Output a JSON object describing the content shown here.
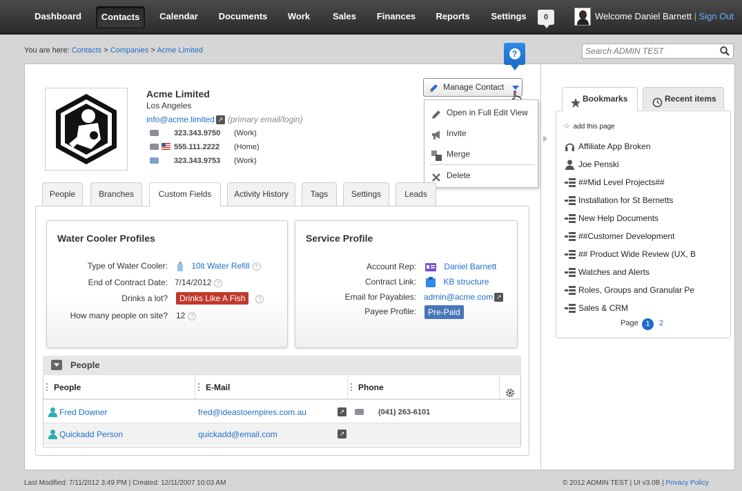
{
  "nav": {
    "items": [
      {
        "label": "Dashboard"
      },
      {
        "label": "Contacts"
      },
      {
        "label": "Calendar"
      },
      {
        "label": "Documents"
      },
      {
        "label": "Work"
      },
      {
        "label": "Sales"
      },
      {
        "label": "Finances"
      },
      {
        "label": "Reports"
      },
      {
        "label": "Settings"
      }
    ],
    "notifications": "0",
    "welcome": "Welcome Daniel Barnett",
    "separator": "|",
    "signout": "Sign Out"
  },
  "breadcrumb": {
    "prefix": "You are here:",
    "items": [
      "Contacts",
      "Companies",
      "Acme Limited"
    ],
    "sep": ">"
  },
  "search": {
    "placeholder": "Search ADMIN TEST"
  },
  "help": {
    "label": "?"
  },
  "contact": {
    "name": "Acme Limited",
    "city": "Los Angeles",
    "email": "info@acme.limited",
    "email_note": "(primary email/login)",
    "phones": [
      {
        "number": "323.343.9750",
        "type": "(Work)"
      },
      {
        "number": "555.111.2222",
        "type": "(Home)"
      },
      {
        "number": "323.343.9753",
        "type": "(Work)"
      }
    ]
  },
  "manage": {
    "label": "Manage Contact",
    "menu": [
      {
        "label": "Open in Full Edit View",
        "icon": "pencil-icon"
      },
      {
        "label": "Invite",
        "icon": "megaphone-icon"
      },
      {
        "label": "Merge",
        "icon": "merge-icon"
      },
      {
        "label": "Delete",
        "icon": "delete-icon"
      }
    ]
  },
  "tabs": [
    {
      "label": "People"
    },
    {
      "label": "Branches"
    },
    {
      "label": "Custom Fields"
    },
    {
      "label": "Activity History"
    },
    {
      "label": "Tags"
    },
    {
      "label": "Settings"
    },
    {
      "label": "Leads"
    }
  ],
  "water": {
    "title": "Water Cooler Profiles",
    "type_label": "Type of Water Cooler:",
    "type_value": "10lt Water Refill",
    "end_label": "End of Contract Date:",
    "end_value": "7/14/2012",
    "drinks_label": "Drinks a lot?",
    "drinks_value": "Drinks Like A Fish",
    "people_label": "How many people on site?",
    "people_value": "12",
    "help": "?"
  },
  "service": {
    "title": "Service Profile",
    "rep_label": "Account Rep:",
    "rep_value": "Daniel Barnett",
    "contract_label": "Contract Link:",
    "contract_value": "KB structure",
    "payables_label": "Email for Payables:",
    "payables_value": "admin@acme.com",
    "payee_label": "Payee Profile:",
    "payee_value": "Pre-Paid"
  },
  "people": {
    "title": "People",
    "columns": [
      "People",
      "E-Mail",
      "Phone"
    ],
    "rows": [
      {
        "name": "Fred Downer",
        "email": "fred@ideastoempires.com.au",
        "phone": "(041) 263-6101"
      },
      {
        "name": "Quickadd Person",
        "email": "quickadd@email.com",
        "phone": ""
      }
    ]
  },
  "sidebar": {
    "bookmarks_tab": "Bookmarks",
    "recent_tab": "Recent items",
    "add_page": "add this page",
    "items": [
      {
        "label": "Affiliate App Broken",
        "icon": "headset-icon"
      },
      {
        "label": "Joe Penski",
        "icon": "person-icon"
      },
      {
        "label": "##Mid Level Projects##",
        "icon": "project-icon"
      },
      {
        "label": "Installation for St Bernetts",
        "icon": "project-icon"
      },
      {
        "label": "New Help Documents",
        "icon": "project-icon"
      },
      {
        "label": "##Customer Development",
        "icon": "project-icon"
      },
      {
        "label": "## Product Wide Review (UX, B",
        "icon": "project-icon"
      },
      {
        "label": "Watches and Alerts",
        "icon": "project-icon"
      },
      {
        "label": "Roles, Groups and Granular Pe",
        "icon": "project-icon"
      },
      {
        "label": "Sales & CRM",
        "icon": "project-icon"
      }
    ],
    "page_label": "Page",
    "pages": [
      "1",
      "2"
    ]
  },
  "footer": {
    "left": "Last Modified: 7/11/2012 3:49 PM | Created: 12/11/2007 10:03 AM",
    "right": "© 2012 ADMIN TEST | UI v3.0B |",
    "privacy": "Privacy Policy"
  },
  "colors": {
    "accent": "#1f6ec7",
    "nav_bg": "#2c2c2c",
    "red_tag": "#c0392b",
    "blue_tag": "#4a76b8"
  }
}
